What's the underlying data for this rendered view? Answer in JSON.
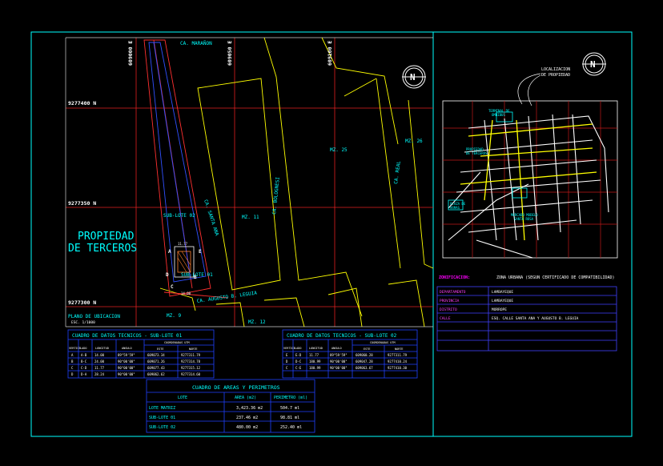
{
  "drawing": {
    "grid_easting": [
      "609000 E",
      "609050 E",
      "609100 E"
    ],
    "grid_northing": [
      "9277400 N",
      "9277350 N",
      "9277300 N"
    ],
    "streets": {
      "maranon": "CA. MARAÑON",
      "real": "CA. REAL",
      "augusto": "CA. AUGUSTO B. LEGUIA",
      "mz26": "MZ. 26",
      "mz25": "MZ. 25",
      "mz11": "MZ. 11",
      "mz12": "MZ. 12",
      "mz9": "MZ. 9",
      "sublote02": "SUB-LOTE 02",
      "sublote01": "SUB-LOTE 01",
      "tercero_1": "PROPIEDAD",
      "tercero_2": "DE TERCEROS",
      "plano": "PLANO DE UBICACION",
      "escala": "ESC. 1/1000",
      "street_b": "CA. BOLOGNESI",
      "street_c": "CA. SANTA ANA",
      "dim_a": "11.77",
      "dim_b": "14.00"
    },
    "points": [
      "A",
      "B",
      "C",
      "D",
      "E"
    ]
  },
  "north": {
    "label": "N"
  },
  "location_map": {
    "annotation_1": "LOCALIZACION",
    "annotation_2": "DE PROPIEDAD",
    "label_a": "TERMINAL DE",
    "label_a2": "OMNIBUS",
    "label_b": "PROPIEDAD",
    "label_b2": "DE TERCEROS",
    "label_c": "PLAZA DE",
    "label_c2": "ARMAS",
    "label_d": "MERCADO MODELO",
    "label_d2": "SANTA ROSA"
  },
  "info": {
    "zonificacion_label": "ZONIFICACION:",
    "zonificacion_value": "ZONA URBANA (SEGUN CERTIFICADO DE COMPATIBILIDAD)",
    "rows": [
      {
        "label": "DEPARTAMENTO",
        "value": "LAMBAYEQUE"
      },
      {
        "label": "PROVINCIA",
        "value": "LAMBAYEQUE"
      },
      {
        "label": "DISTRITO",
        "value": "MORROPE"
      },
      {
        "label": "CALLE",
        "value": "ESQ. CALLE SANTA ANA Y AUGUSTO B. LEGUIA"
      }
    ]
  },
  "table_lote01": {
    "title": "CUADRO DE DATOS TECNICOS - SUB-LOTE 01",
    "headers": [
      "VERTICE",
      "LADO",
      "LONGITUD",
      "ANGULO",
      "ESTE",
      "NORTE"
    ],
    "group_header": "COORDENADAS UTM",
    "rows": [
      [
        "A",
        "A-B",
        "14.00",
        "89°59'59\"",
        "609073.34",
        "9277311.79"
      ],
      [
        "B",
        "B-C",
        "24.00",
        "90°00'00\"",
        "609071.26",
        "9277314.78"
      ],
      [
        "C",
        "C-D",
        "11.77",
        "90°00'00\"",
        "609077.43",
        "9277315.12"
      ],
      [
        "D",
        "D-A",
        "28.24",
        "90°00'00\"",
        "609062.62",
        "9277314.60"
      ]
    ]
  },
  "table_lote02": {
    "title": "CUADRO DE DATOS TECNICOS - SUB-LOTE 02",
    "headers": [
      "VERTICE",
      "LADO",
      "LONGITUD",
      "ANGULO",
      "ESTE",
      "NORTE"
    ],
    "group_header": "COORDENADAS UTM",
    "rows": [
      [
        "E",
        "E-D",
        "11.77",
        "89°59'59\"",
        "609060.28",
        "9277311.79"
      ],
      [
        "D",
        "D-C",
        "180.99",
        "90°00'00\"",
        "609047.28",
        "9277410.24"
      ],
      [
        "C",
        "C-E",
        "180.99",
        "90°00'00\"",
        "609063.67",
        "9277410.30"
      ]
    ]
  },
  "table_areas": {
    "title": "CUADRO DE AREAS Y PERIMETROS",
    "headers": [
      "LOTE",
      "AREA (m2)",
      "PERIMETRO (ml)"
    ],
    "rows": [
      [
        "LOTE MATRIZ",
        "3,423.36 m2",
        "504.7 ml"
      ],
      [
        "SUB-LOTE 01",
        "237.46 m2",
        "98.81 ml"
      ],
      [
        "SUB-LOTE 02",
        "480.00 m2",
        "252.40 ml"
      ]
    ]
  },
  "colors": {
    "frame": "#00ffff",
    "grid": "#ff2020",
    "block": "#ffff00",
    "text_cyan": "#00ffff",
    "lot": "#0000ff",
    "table_line": "#2020ff"
  }
}
